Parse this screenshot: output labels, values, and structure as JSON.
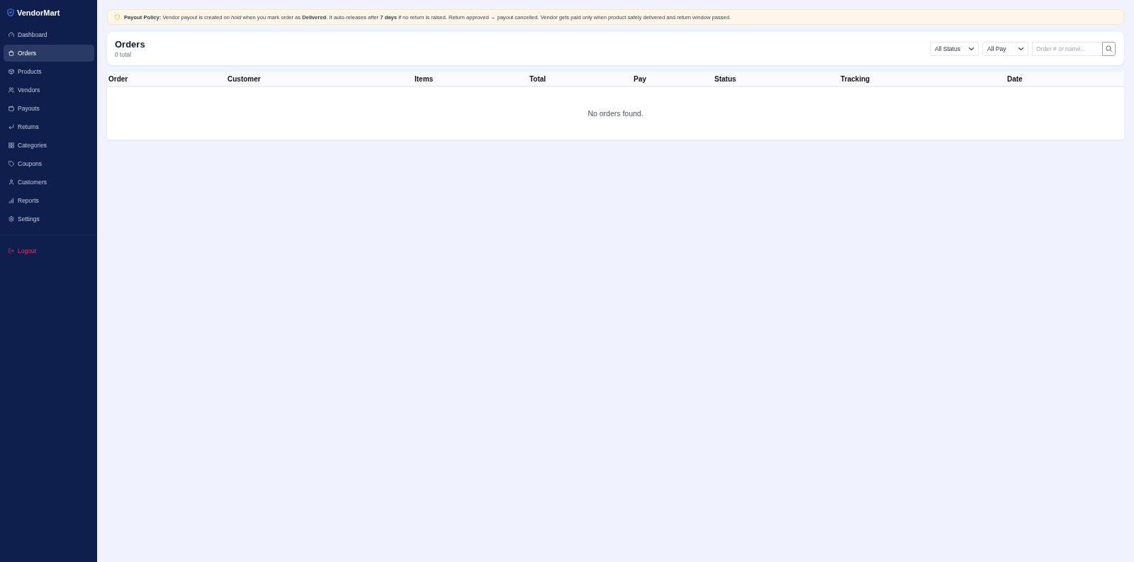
{
  "sidebar": {
    "brand": "VendorMart",
    "items": [
      {
        "label": "Dashboard",
        "selected": false
      },
      {
        "label": "Orders",
        "selected": true
      },
      {
        "label": "Products",
        "selected": false
      },
      {
        "label": "Vendors",
        "selected": false
      },
      {
        "label": "Payouts",
        "selected": false
      },
      {
        "label": "Returns",
        "selected": false
      },
      {
        "label": "Categories",
        "selected": false
      },
      {
        "label": "Coupons",
        "selected": false
      },
      {
        "label": "Customers",
        "selected": false
      },
      {
        "label": "Reports",
        "selected": false
      },
      {
        "label": "Settings",
        "selected": false
      }
    ],
    "logout": {
      "label": "Logout"
    }
  },
  "banner": {
    "text": "**Payout Policy:** Vendor payout is created *on hold* when you mark order as **Delivered**. It auto-releases after **7 days** if no return is raised. Return approved → payout cancelled. Vendor gets paid only when product safely delivered and return window passed."
  },
  "header": {
    "title": "Orders",
    "subtitle": "0 total"
  },
  "filters": [
    {
      "label": "All Status"
    },
    {
      "label": "All Pay"
    }
  ],
  "search": {
    "placeholder": "Order # or name..."
  },
  "table": {
    "columns": [
      "Order",
      "Customer",
      "Items",
      "Total",
      "Pay",
      "Status",
      "Tracking",
      "Date"
    ],
    "empty_message": "No orders found."
  }
}
